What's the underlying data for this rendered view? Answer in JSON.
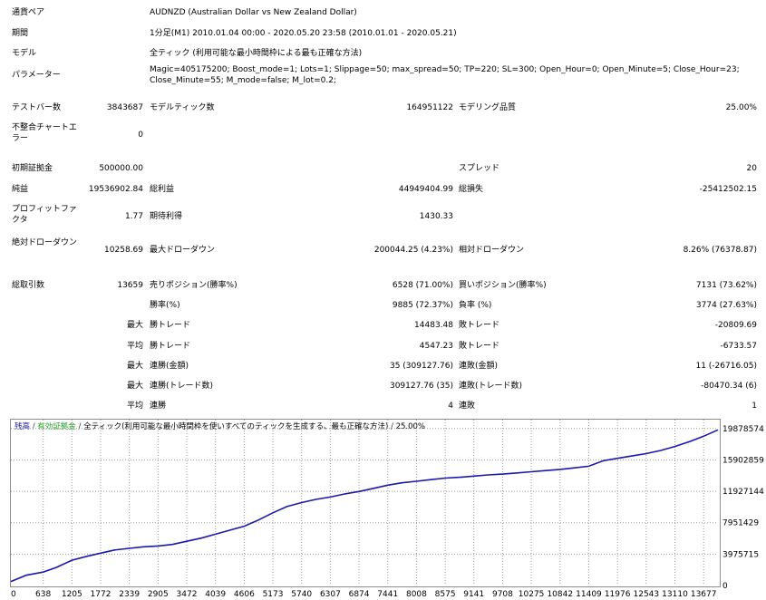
{
  "report": {
    "symbol": {
      "label": "通貨ペア",
      "value": "AUDNZD (Australian Dollar vs New Zealand Dollar)"
    },
    "period": {
      "label": "期間",
      "value": "1分足(M1) 2010.01.04 00:00 - 2020.05.20 23:58 (2010.01.01 - 2020.05.21)"
    },
    "model": {
      "label": "モデル",
      "value": "全ティック (利用可能な最小時間枠による最も正確な方法)"
    },
    "parameters": {
      "label": "パラメーター",
      "value": "Magic=405175200; Boost_mode=1; Lots=1; Slippage=50; max_spread=50; TP=220; SL=300; Open_Hour=0; Open_Minute=5; Close_Hour=23; Close_Minute=55; M_mode=false; M_lot=0.2;"
    },
    "bars": {
      "label": "テストバー数",
      "value": "3843687"
    },
    "ticks": {
      "label": "モデルティック数",
      "value": "164951122"
    },
    "quality": {
      "label": "モデリング品質",
      "value": "25.00%"
    },
    "mismatch": {
      "label": "不整合チャートエラー",
      "value": "0"
    },
    "deposit": {
      "label": "初期証拠金",
      "value": "500000.00"
    },
    "spread": {
      "label": "スプレッド",
      "value": "20"
    },
    "net_profit": {
      "label": "純益",
      "value": "19536902.84"
    },
    "gross_profit": {
      "label": "総利益",
      "value": "44949404.99"
    },
    "gross_loss": {
      "label": "総損失",
      "value": "-25412502.15"
    },
    "profit_factor": {
      "label": "プロフィットファクタ",
      "value": "1.77"
    },
    "expected_payoff": {
      "label": "期待利得",
      "value": "1430.33"
    },
    "abs_drawdown": {
      "label": "絶対ドローダウン",
      "value": "10258.69"
    },
    "max_drawdown": {
      "label": "最大ドローダウン",
      "value": "200044.25 (4.23%)"
    },
    "rel_drawdown": {
      "label": "相対ドローダウン",
      "value": "8.26% (76378.87)"
    },
    "total_trades": {
      "label": "総取引数",
      "value": "13659"
    },
    "short_positions": {
      "label": "売りポジション(勝率%)",
      "value": "6528 (71.00%)"
    },
    "long_positions": {
      "label": "買いポジション(勝率%)",
      "value": "7131 (73.62%)"
    },
    "win_rate": {
      "label": "勝率(%)",
      "value": "9885 (72.37%)"
    },
    "loss_rate": {
      "label": "負率 (%)",
      "value": "3774 (27.63%)"
    },
    "largest_win": {
      "prefix": "最大",
      "label": "勝トレード",
      "value": "14483.48"
    },
    "largest_loss": {
      "label": "敗トレード",
      "value": "-20809.69"
    },
    "average_win": {
      "prefix": "平均",
      "label": "勝トレード",
      "value": "4547.23"
    },
    "average_loss": {
      "label": "敗トレード",
      "value": "-6733.57"
    },
    "max_consec_wins": {
      "prefix": "最大",
      "label": "連勝(金額)",
      "value": "35 (309127.76)"
    },
    "max_consec_losses": {
      "label": "連敗(金額)",
      "value": "11 (-26716.05)"
    },
    "max_consec_profit": {
      "prefix": "最大",
      "label": "連勝(トレード数)",
      "value": "309127.76 (35)"
    },
    "max_consec_loss": {
      "label": "連敗(トレード数)",
      "value": "-80470.34 (6)"
    },
    "avg_consec_wins": {
      "prefix": "平均",
      "label": "連勝",
      "value": "4"
    },
    "avg_consec_losses": {
      "label": "連敗",
      "value": "1"
    }
  },
  "chart_data": {
    "type": "line",
    "legend": {
      "balance": "残高",
      "equity": "有効証拠金",
      "model": "全ティック(利用可能な最小時間枠を使いすべてのティックを生成する、最も正確な方法)",
      "quality": "25.00%"
    },
    "xlim": [
      0,
      13960
    ],
    "ylim": [
      0,
      21000000
    ],
    "x_ticks": [
      0,
      638,
      1205,
      1772,
      2339,
      2905,
      3472,
      4039,
      4606,
      5173,
      5740,
      6307,
      6874,
      7441,
      8008,
      8575,
      9141,
      9708,
      10275,
      10842,
      11409,
      11976,
      12543,
      13110,
      13677
    ],
    "y_ticks": [
      0,
      3975715,
      7951429,
      11927144,
      15902859,
      19878574
    ],
    "colors": {
      "balance": "#1a1aa8",
      "grid": "#9a9a9a"
    },
    "series": [
      {
        "name": "残高",
        "x": [
          0,
          300,
          638,
          900,
          1205,
          1500,
          1772,
          2050,
          2339,
          2620,
          2905,
          3190,
          3472,
          3760,
          4039,
          4320,
          4606,
          4890,
          5173,
          5450,
          5740,
          6020,
          6307,
          6600,
          6874,
          7160,
          7441,
          7720,
          8008,
          8290,
          8575,
          8860,
          9141,
          9420,
          9708,
          10000,
          10275,
          10560,
          10842,
          11130,
          11409,
          11700,
          11976,
          12260,
          12543,
          12830,
          13110,
          13390,
          13677,
          13960
        ],
        "y": [
          500000,
          1300000,
          1700000,
          2300000,
          3200000,
          3700000,
          4100000,
          4500000,
          4700000,
          4900000,
          5000000,
          5200000,
          5600000,
          6000000,
          6500000,
          7000000,
          7500000,
          8300000,
          9200000,
          10000000,
          10500000,
          10900000,
          11200000,
          11600000,
          11900000,
          12300000,
          12700000,
          13000000,
          13200000,
          13400000,
          13600000,
          13700000,
          13850000,
          14000000,
          14100000,
          14250000,
          14400000,
          14550000,
          14700000,
          14900000,
          15100000,
          15800000,
          16100000,
          16400000,
          16700000,
          17100000,
          17600000,
          18200000,
          18900000,
          19700000
        ]
      }
    ]
  }
}
